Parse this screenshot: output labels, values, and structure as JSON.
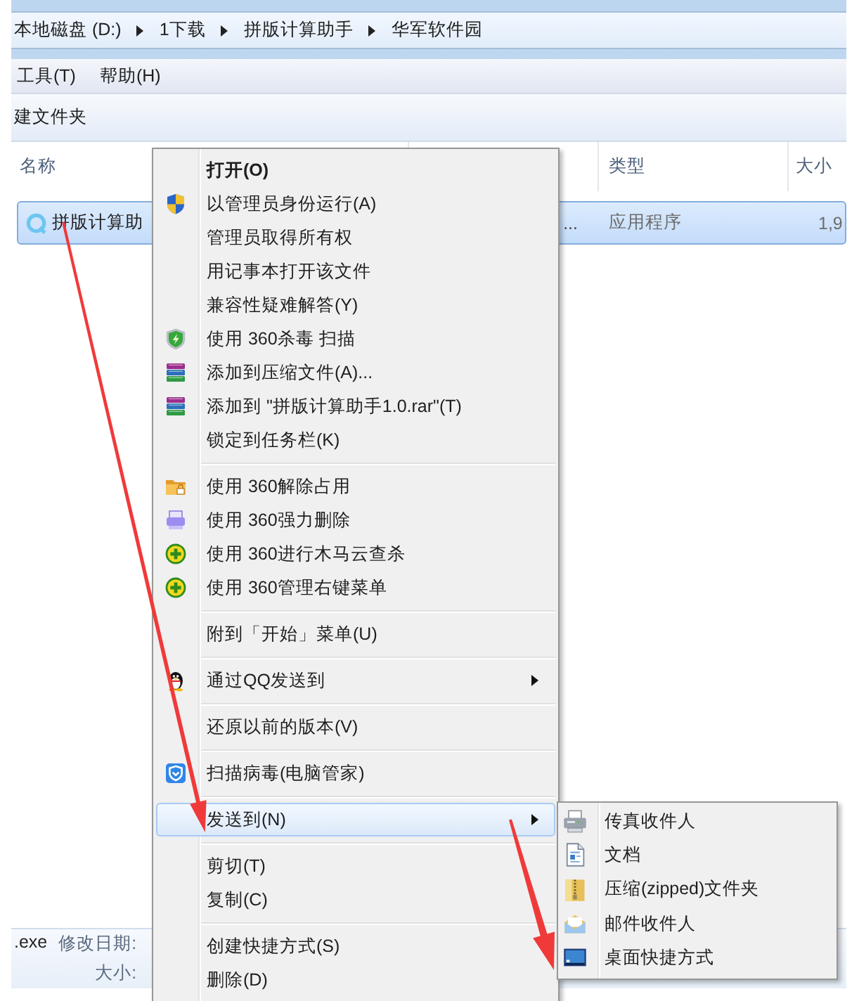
{
  "address_bar": {
    "crumbs": [
      {
        "label": "本地磁盘 (D:)"
      },
      {
        "label": "1下载"
      },
      {
        "label": "拼版计算助手"
      },
      {
        "label": "华军软件园"
      }
    ]
  },
  "menu_bar": {
    "items": [
      {
        "label": "工具(T)"
      },
      {
        "label": "帮助(H)"
      }
    ]
  },
  "toolbar": {
    "buttons": [
      {
        "label": "建文件夹"
      }
    ]
  },
  "file_list": {
    "columns": [
      {
        "label": "名称"
      },
      {
        "label": "类型"
      },
      {
        "label": "大小"
      }
    ],
    "rows": [
      {
        "name": "拼版计算助",
        "column_2": "...",
        "type": "应用程序",
        "size": "1,9",
        "selected": true
      }
    ]
  },
  "details_pane": {
    "file_name": ".exe",
    "modified_label": "修改日期:",
    "size_label": "大小:"
  },
  "context_menu": {
    "groups": [
      {
        "items": [
          {
            "label": "打开(O)",
            "kind": "plain",
            "default": true,
            "selected": false,
            "submenu": false
          },
          {
            "label": "以管理员身份运行(A)",
            "kind": "uac",
            "default": false,
            "selected": false,
            "submenu": false
          },
          {
            "label": "管理员取得所有权",
            "kind": "plain",
            "default": false,
            "selected": false,
            "submenu": false
          },
          {
            "label": "用记事本打开该文件",
            "kind": "plain",
            "default": false,
            "selected": false,
            "submenu": false
          },
          {
            "label": "兼容性疑难解答(Y)",
            "kind": "plain",
            "default": false,
            "selected": false,
            "submenu": false
          },
          {
            "label": "使用 360杀毒 扫描",
            "kind": "antivirus",
            "default": false,
            "selected": false,
            "submenu": false
          },
          {
            "label": "添加到压缩文件(A)...",
            "kind": "archive",
            "default": false,
            "selected": false,
            "submenu": false
          },
          {
            "label": "添加到 \"拼版计算助手1.0.rar\"(T)",
            "kind": "archive",
            "default": false,
            "selected": false,
            "submenu": false
          },
          {
            "label": "锁定到任务栏(K)",
            "kind": "plain",
            "default": false,
            "selected": false,
            "submenu": false
          }
        ]
      },
      {
        "items": [
          {
            "label": "使用 360解除占用",
            "kind": "unlock",
            "default": false,
            "selected": false,
            "submenu": false
          },
          {
            "label": "使用 360强力删除",
            "kind": "shred",
            "default": false,
            "selected": false,
            "submenu": false
          },
          {
            "label": "使用 360进行木马云查杀",
            "kind": "scan",
            "default": false,
            "selected": false,
            "submenu": false
          },
          {
            "label": "使用 360管理右键菜单",
            "kind": "scan",
            "default": false,
            "selected": false,
            "submenu": false
          }
        ]
      },
      {
        "items": [
          {
            "label": "附到「开始」菜单(U)",
            "kind": "plain",
            "default": false,
            "selected": false,
            "submenu": false
          }
        ]
      },
      {
        "items": [
          {
            "label": "通过QQ发送到",
            "kind": "qq",
            "default": false,
            "selected": false,
            "submenu": true
          }
        ]
      },
      {
        "items": [
          {
            "label": "还原以前的版本(V)",
            "kind": "plain",
            "default": false,
            "selected": false,
            "submenu": false
          }
        ]
      },
      {
        "items": [
          {
            "label": "扫描病毒(电脑管家)",
            "kind": "guard",
            "default": false,
            "selected": false,
            "submenu": false
          }
        ]
      },
      {
        "items": [
          {
            "label": "发送到(N)",
            "kind": "plain",
            "default": false,
            "selected": true,
            "submenu": true
          }
        ]
      },
      {
        "items": [
          {
            "label": "剪切(T)",
            "kind": "plain",
            "default": false,
            "selected": false,
            "submenu": false
          },
          {
            "label": "复制(C)",
            "kind": "plain",
            "default": false,
            "selected": false,
            "submenu": false
          }
        ]
      },
      {
        "items": [
          {
            "label": "创建快捷方式(S)",
            "kind": "plain",
            "default": false,
            "selected": false,
            "submenu": false
          },
          {
            "label": "删除(D)",
            "kind": "plain",
            "default": false,
            "selected": false,
            "submenu": false
          }
        ]
      }
    ]
  },
  "send_to_menu": {
    "items": [
      {
        "label": "传真收件人",
        "kind": "fax"
      },
      {
        "label": "文档",
        "kind": "document"
      },
      {
        "label": "压缩(zipped)文件夹",
        "kind": "zip"
      },
      {
        "label": "邮件收件人",
        "kind": "mail"
      },
      {
        "label": "桌面快捷方式",
        "kind": "desktop"
      }
    ]
  }
}
